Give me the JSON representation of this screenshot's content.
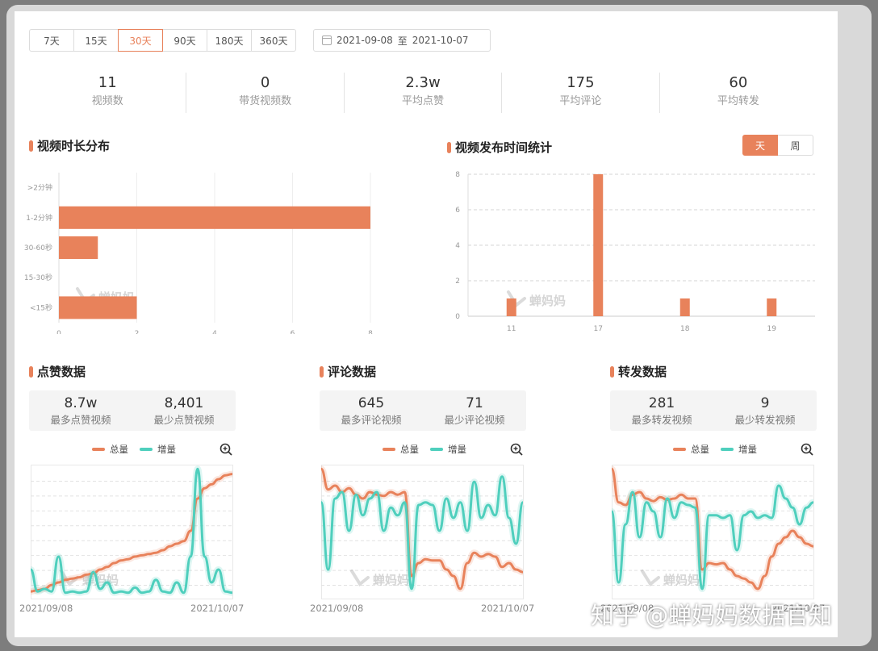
{
  "range_tabs": [
    "7天",
    "15天",
    "30天",
    "90天",
    "180天",
    "360天"
  ],
  "active_tab": "30天",
  "date_range": {
    "start": "2021-09-08",
    "sep": "至",
    "end": "2021-10-07"
  },
  "stats": [
    {
      "value": "11",
      "label": "视频数"
    },
    {
      "value": "0",
      "label": "带货视频数"
    },
    {
      "value": "2.3w",
      "label": "平均点赞"
    },
    {
      "value": "175",
      "label": "平均评论"
    },
    {
      "value": "60",
      "label": "平均转发"
    }
  ],
  "duration_section": {
    "title": "视频时长分布"
  },
  "publish_section": {
    "title": "视频发布时间统计",
    "toggle": [
      "天",
      "周"
    ]
  },
  "watermark": "蝉妈妈",
  "corner_watermark": "知乎 @蝉妈妈数据官知",
  "colors": {
    "accent": "#e8825b",
    "teal": "#4fcfbd"
  },
  "chart_data": [
    {
      "type": "bar",
      "orientation": "horizontal",
      "categories": [
        ">2分钟",
        "1-2分钟",
        "30-60秒",
        "15-30秒",
        "<15秒"
      ],
      "values": [
        0,
        8,
        1,
        0,
        2
      ],
      "xticks": [
        "0",
        "2",
        "4",
        "6",
        "8"
      ],
      "xlim": [
        0,
        8
      ]
    },
    {
      "type": "bar",
      "categories": [
        "11",
        "17",
        "18",
        "19"
      ],
      "values": [
        1,
        8,
        1,
        1
      ],
      "yticks": [
        "0",
        "2",
        "4",
        "6",
        "8"
      ],
      "ylim": [
        0,
        8
      ]
    }
  ],
  "panels": [
    {
      "title": "点赞数据",
      "max_value": "8.7w",
      "max_label": "最多点赞视频",
      "min_value": "8,401",
      "min_label": "最少点赞视频",
      "legend_total": "总量",
      "legend_inc": "增量",
      "x_start": "2021/09/08",
      "x_end": "2021/10/07",
      "total": [
        0.03,
        0.04,
        0.05,
        0.08,
        0.1,
        0.12,
        0.13,
        0.14,
        0.16,
        0.17,
        0.2,
        0.22,
        0.25,
        0.27,
        0.28,
        0.3,
        0.31,
        0.32,
        0.33,
        0.35,
        0.38,
        0.4,
        0.42,
        0.5,
        0.75,
        0.83,
        0.86,
        0.9,
        0.93,
        0.94
      ],
      "inc": [
        0.2,
        0.03,
        0.05,
        0.03,
        0.3,
        0.02,
        0.03,
        0.02,
        0.03,
        0.18,
        0.05,
        0.1,
        0.02,
        0.03,
        0.02,
        0.06,
        0.02,
        0.03,
        0.12,
        0.03,
        0.02,
        0.1,
        0.02,
        0.3,
        0.98,
        0.3,
        0.1,
        0.2,
        0.03,
        0.02
      ]
    },
    {
      "title": "评论数据",
      "max_value": "645",
      "max_label": "最多评论视频",
      "min_value": "71",
      "min_label": "最少评论视频",
      "legend_total": "总量",
      "legend_inc": "增量",
      "x_start": "2021/09/08",
      "x_end": "2021/10/07",
      "total": [
        0.98,
        0.82,
        0.85,
        0.8,
        0.83,
        0.78,
        0.75,
        0.8,
        0.78,
        0.77,
        0.8,
        0.78,
        0.8,
        0.15,
        0.25,
        0.28,
        0.27,
        0.27,
        0.2,
        0.15,
        0.05,
        0.25,
        0.33,
        0.3,
        0.32,
        0.3,
        0.22,
        0.25,
        0.2,
        0.18
      ],
      "inc": [
        0.72,
        0.2,
        0.75,
        0.8,
        0.5,
        0.78,
        0.62,
        0.75,
        0.8,
        0.5,
        0.68,
        0.62,
        0.72,
        0.05,
        0.7,
        0.72,
        0.7,
        0.5,
        0.75,
        0.6,
        0.72,
        0.5,
        0.88,
        0.6,
        0.7,
        0.62,
        0.92,
        0.6,
        0.4,
        0.72
      ]
    },
    {
      "title": "转发数据",
      "max_value": "281",
      "max_label": "最多转发视频",
      "min_value": "9",
      "min_label": "最少转发视频",
      "legend_total": "总量",
      "legend_inc": "增量",
      "x_start": "2021/09/08",
      "x_end": "2021/10/07",
      "total": [
        0.98,
        0.72,
        0.7,
        0.78,
        0.8,
        0.75,
        0.73,
        0.76,
        0.74,
        0.75,
        0.78,
        0.75,
        0.75,
        0.2,
        0.25,
        0.24,
        0.25,
        0.2,
        0.15,
        0.13,
        0.1,
        0.05,
        0.15,
        0.3,
        0.4,
        0.45,
        0.5,
        0.45,
        0.4,
        0.38
      ],
      "inc": [
        0.65,
        0.1,
        0.55,
        0.8,
        0.45,
        0.72,
        0.65,
        0.45,
        0.75,
        0.6,
        0.72,
        0.7,
        0.68,
        0.05,
        0.62,
        0.62,
        0.6,
        0.62,
        0.35,
        0.62,
        0.65,
        0.6,
        0.62,
        0.6,
        0.85,
        0.75,
        0.68,
        0.55,
        0.68,
        0.72
      ]
    }
  ]
}
